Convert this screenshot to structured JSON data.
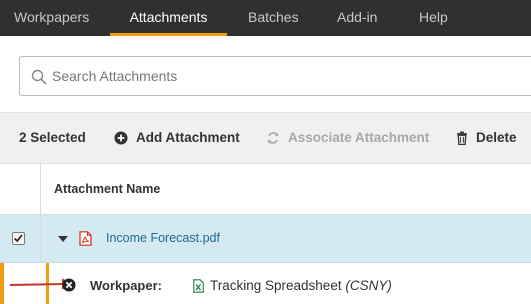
{
  "nav": {
    "tabs": [
      {
        "label": "Workpapers"
      },
      {
        "label": "Attachments",
        "active": true
      },
      {
        "label": "Batches"
      },
      {
        "label": "Add-in"
      },
      {
        "label": "Help"
      }
    ]
  },
  "search": {
    "placeholder": "Search Attachments",
    "value": ""
  },
  "toolbar": {
    "selected_count": "2 Selected",
    "add_label": "Add Attachment",
    "associate_label": "Associate Attachment",
    "delete_label": "Delete"
  },
  "grid": {
    "column_header": "Attachment Name",
    "rows": [
      {
        "file_name": "Income Forecast.pdf",
        "checked": true,
        "expanded": true
      }
    ]
  },
  "workpaper": {
    "label": "Workpaper:",
    "name": "Tracking Spreadsheet",
    "client": "(CSNY)"
  },
  "colors": {
    "nav_bg": "#303030",
    "accent": "#f39c12",
    "selected_row": "#d4eaf3",
    "link": "#1f6a92",
    "pdf_red": "#d9261c",
    "excel_green": "#1e7d45",
    "arrow_red": "#c0392b"
  },
  "icons": [
    "search-icon",
    "plus-circle-icon",
    "link-refresh-icon",
    "trash-icon",
    "caret-down-icon",
    "pdf-file-icon",
    "close-circle-icon",
    "excel-file-icon",
    "red-arrow"
  ]
}
